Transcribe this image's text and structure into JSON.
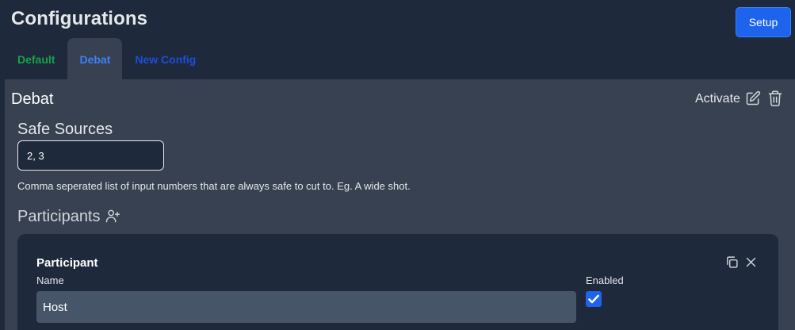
{
  "page": {
    "title": "Configurations",
    "setup_label": "Setup"
  },
  "tabs": [
    {
      "label": "Default"
    },
    {
      "label": "Debat"
    },
    {
      "label": "New Config"
    }
  ],
  "config": {
    "name": "Debat",
    "activate_label": "Activate",
    "safe_sources": {
      "label": "Safe Sources",
      "value": "2, 3",
      "helper": "Comma seperated list of input numbers that are always safe to cut to. Eg. A wide shot."
    },
    "participants": {
      "label": "Participants",
      "items": [
        {
          "title": "Participant",
          "name_label": "Name",
          "name_value": "Host",
          "enabled_label": "Enabled",
          "enabled": true
        }
      ]
    }
  },
  "colors": {
    "background": "#1e293b",
    "panel": "#374151",
    "primary": "#1d63ed",
    "tab_default": "#16a34a",
    "tab_active": "#3b82f6",
    "tab_new": "#1d4ed8"
  },
  "icons": [
    "edit-icon",
    "trash-icon",
    "add-person-icon",
    "copy-icon",
    "close-icon",
    "checkmark-icon"
  ]
}
